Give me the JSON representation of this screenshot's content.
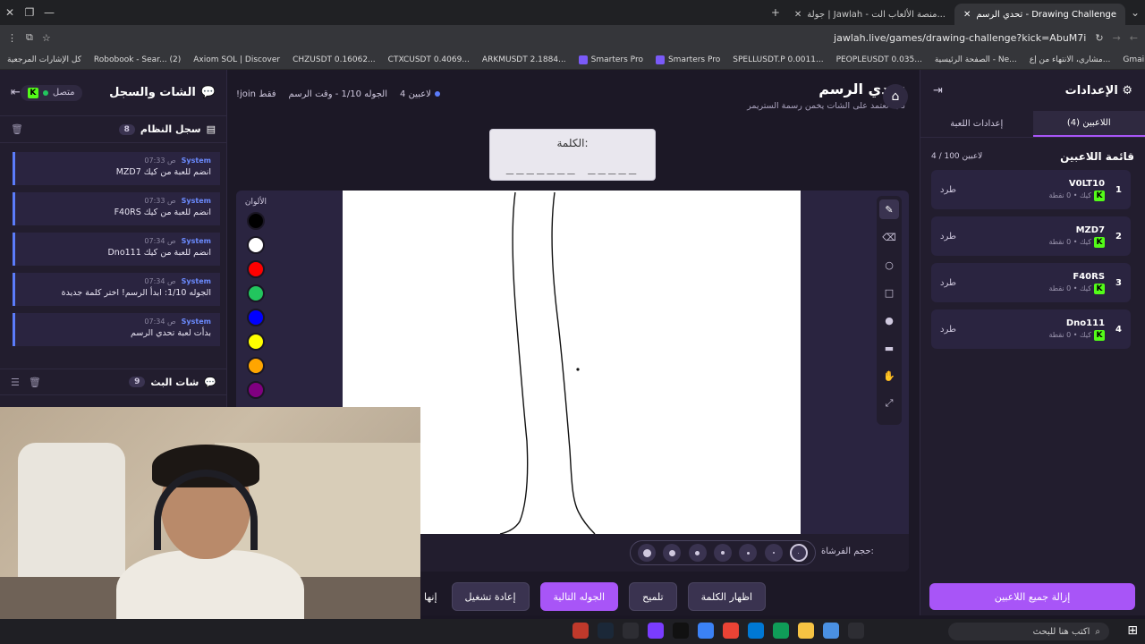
{
  "browser": {
    "tabs": [
      {
        "label": "تحدي الرسم - Drawing Challenge",
        "active": true
      },
      {
        "label": "جولة | Jawlah - منصة الألعاب الت...",
        "active": false
      }
    ],
    "url": "jawlah.live/games/drawing-challenge?kick=AbuM7i",
    "bookmarks": [
      "Gmail",
      "مشاري، الانتهاء من إع...",
      "الصفحة الرئيسية - Ne...",
      "PEOPLEUSDT 0.035...",
      "SPELLUSDT.P 0.0011...",
      "Smarters Pro",
      "Smarters Pro",
      "ARKMUSDT 2.1884...",
      "CTXCUSDT 0.4069...",
      "CHZUSDT 0.16062...",
      "Axiom SOL | Discover",
      "Robobook - Sear... (2)",
      "كل الإشارات المرجعية"
    ]
  },
  "chat_panel": {
    "title": "الشات والسجل",
    "status": "متصل",
    "system_log": {
      "title": "سجل النظام",
      "count": "8"
    },
    "messages": [
      {
        "who": "System",
        "time": "07:33 ص",
        "text": "MZD7 انضم للعبة من كيك"
      },
      {
        "who": "System",
        "time": "07:33 ص",
        "text": "F40RS انضم للعبة من كيك"
      },
      {
        "who": "System",
        "time": "07:34 ص",
        "text": "Dno111 انضم للعبة من كيك"
      },
      {
        "who": "System",
        "time": "07:34 ص",
        "text": "الجوله 1/10: ابدأ الرسم! اختر كلمة جديدة"
      },
      {
        "who": "System",
        "time": "07:34 ص",
        "text": "بدأت لعبة تحدي الرسم"
      }
    ],
    "stream_chat": {
      "title": "شات البث",
      "count": "9"
    }
  },
  "header": {
    "title": "تحدي الرسم",
    "subtitle": "لعبة تعتمد على الشات يخمن رسمة الستريمر",
    "players_count": "4 لاعبين",
    "round": "الجوله 1/10 - وقت الرسم",
    "join_hint": "!join فقط"
  },
  "word": {
    "label": "الكلمة:",
    "blanks": "_______   _____"
  },
  "board": {
    "colors_label": "الألوان",
    "colors": [
      "#000000",
      "#ffffff",
      "#ff0000",
      "#22c55e",
      "#0000ff",
      "#ffff00",
      "#ffa500",
      "#800080"
    ],
    "tools": [
      "pen-icon",
      "eraser-icon",
      "circle-icon",
      "rectangle-icon",
      "fill-dot-icon",
      "line-icon",
      "hand-icon",
      "resize-icon"
    ],
    "brush_label": "حجم الفرشاة:",
    "brush_sizes": [
      9,
      7,
      5,
      4,
      3,
      2,
      1
    ]
  },
  "controls": {
    "show_word": "اظهار الكلمة",
    "hint": "تلميح",
    "next_round": "الجوله التالية",
    "restart": "إعادة تشغيل",
    "end": "إنها"
  },
  "settings": {
    "title": "الإعدادات",
    "tab_players": "اللاعبين (4)",
    "tab_game": "إعدادات اللعبة",
    "list_title": "قائمة اللاعبين",
    "list_count": "4 / 100 لاعبين",
    "kick_label": "طرد",
    "players": [
      {
        "num": "1",
        "name": "V0LT10",
        "meta": "كيك • 0 نقطة"
      },
      {
        "num": "2",
        "name": "MZD7",
        "meta": "كيك • 0 نقطة"
      },
      {
        "num": "3",
        "name": "F40RS",
        "meta": "كيك • 0 نقطة"
      },
      {
        "num": "4",
        "name": "Dno111",
        "meta": "كيك • 0 نقطة"
      }
    ],
    "remove_all": "إزالة جميع اللاعبين"
  },
  "taskbar": {
    "search_placeholder": "اكتب هنا للبحث"
  }
}
